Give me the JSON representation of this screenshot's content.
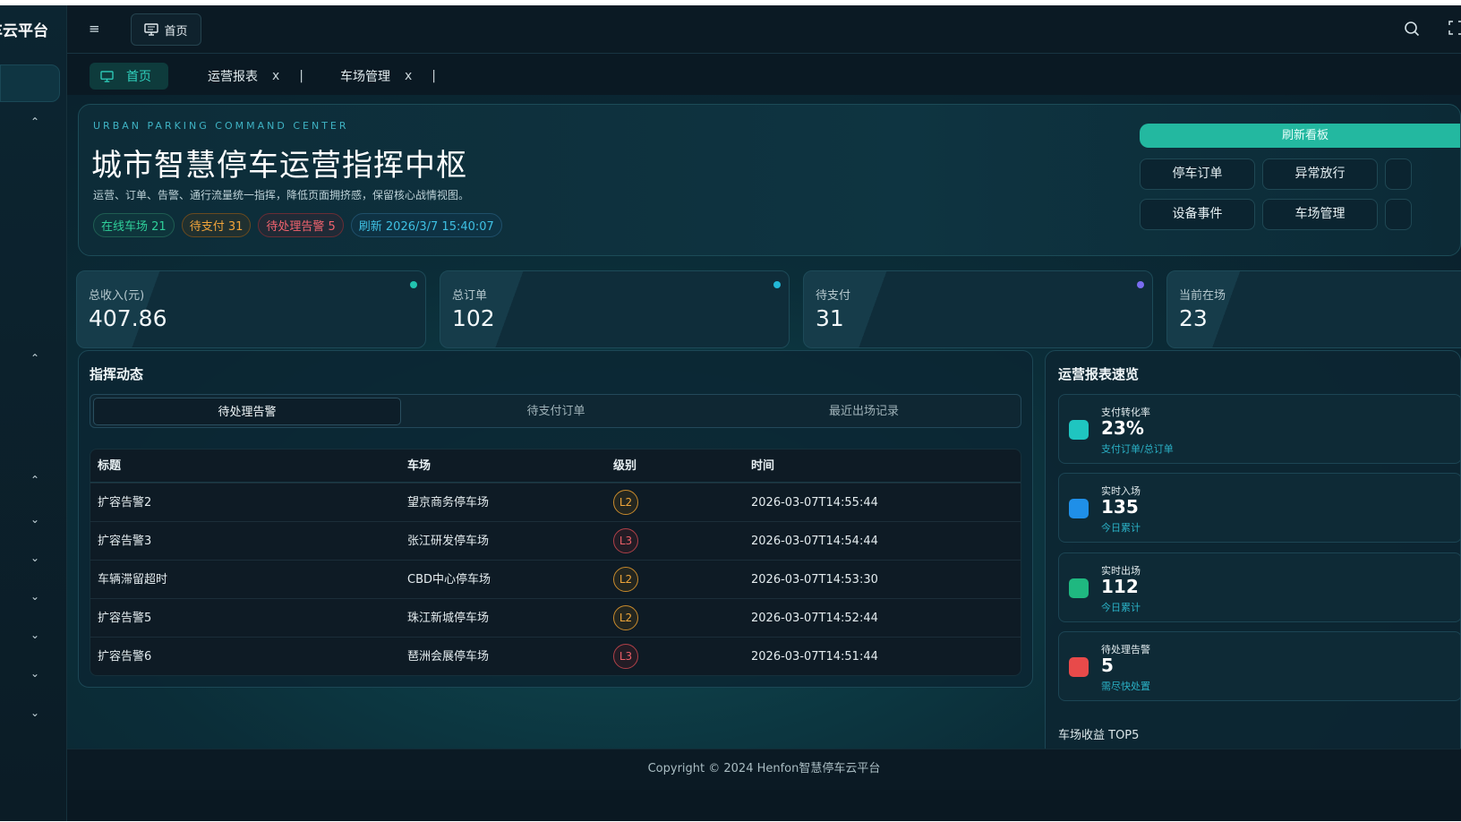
{
  "app": {
    "brand": "车云平台"
  },
  "topbar": {
    "home_label": "首页"
  },
  "tabs": [
    {
      "label": "首页"
    },
    {
      "label": "运营报表",
      "close": "x"
    },
    {
      "label": "车场管理",
      "close": "x"
    }
  ],
  "hero": {
    "kicker": "URBAN PARKING COMMAND CENTER",
    "title": "城市智慧停车运营指挥中枢",
    "subtitle": "运营、订单、告警、通行流量统一指挥，降低页面拥挤感，保留核心战情视图。",
    "chips": {
      "online": "在线车场 21",
      "pending_pay": "待支付 31",
      "alerts": "待处理告警 5",
      "refresh": "刷新 2026/3/7 15:40:07"
    },
    "refresh_button": "刷新看板",
    "buttons": [
      "停车订单",
      "异常放行",
      "设备事件",
      "车场管理"
    ]
  },
  "stats": [
    {
      "label": "总收入(元)",
      "value": "407.86",
      "dot_color": "#22c3b0"
    },
    {
      "label": "总订单",
      "value": "102",
      "dot_color": "#22b7d6"
    },
    {
      "label": "待支付",
      "value": "31",
      "dot_color": "#7a6cf0"
    },
    {
      "label": "当前在场",
      "value": "23",
      "dot_color": "#22b7d6"
    }
  ],
  "command": {
    "title": "指挥动态",
    "segments": [
      "待处理告警",
      "待支付订单",
      "最近出场记录"
    ],
    "columns": [
      "标题",
      "车场",
      "级别",
      "时间"
    ],
    "rows": [
      {
        "title": "扩容告警2",
        "lot": "望京商务停车场",
        "level": "L2",
        "time": "2026-03-07T14:55:44"
      },
      {
        "title": "扩容告警3",
        "lot": "张江研发停车场",
        "level": "L3",
        "time": "2026-03-07T14:54:44"
      },
      {
        "title": "车辆滞留超时",
        "lot": "CBD中心停车场",
        "level": "L2",
        "time": "2026-03-07T14:53:30"
      },
      {
        "title": "扩容告警5",
        "lot": "珠江新城停车场",
        "level": "L2",
        "time": "2026-03-07T14:52:44"
      },
      {
        "title": "扩容告警6",
        "lot": "琶洲会展停车场",
        "level": "L3",
        "time": "2026-03-07T14:51:44"
      }
    ]
  },
  "report": {
    "title": "运营报表速览",
    "cards": [
      {
        "label": "支付转化率",
        "value": "23%",
        "note": "支付订单/总订单",
        "color": "#1fc5c0"
      },
      {
        "label": "实时入场",
        "value": "135",
        "note": "今日累计",
        "color": "#1f8fe8"
      },
      {
        "label": "实时出场",
        "value": "112",
        "note": "今日累计",
        "color": "#1fb880"
      },
      {
        "label": "待处理告警",
        "value": "5",
        "note": "需尽快处置",
        "color": "#e84a4a"
      }
    ],
    "top5_title": "车场收益 TOP5"
  },
  "footer": {
    "copyright": "Copyright © 2024 Henfon智慧停车云平台"
  }
}
